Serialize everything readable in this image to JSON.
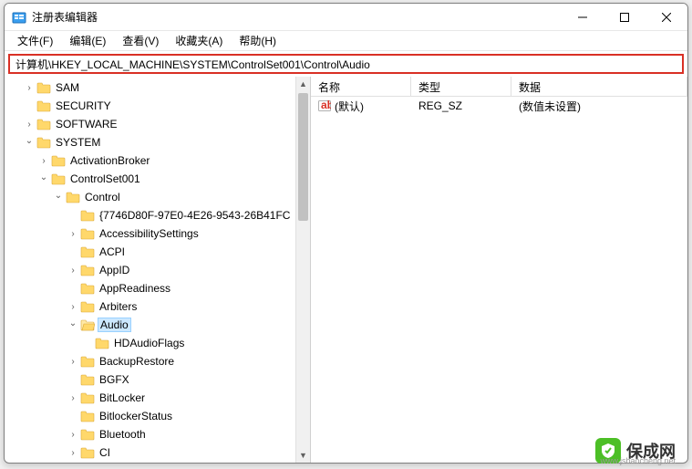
{
  "window": {
    "title": "注册表编辑器"
  },
  "menu": {
    "file": "文件(F)",
    "edit": "编辑(E)",
    "view": "查看(V)",
    "favorites": "收藏夹(A)",
    "help": "帮助(H)"
  },
  "address": "计算机\\HKEY_LOCAL_MACHINE\\SYSTEM\\ControlSet001\\Control\\Audio",
  "columns": {
    "name": "名称",
    "type": "类型",
    "data": "数据"
  },
  "row": {
    "name": "(默认)",
    "type": "REG_SZ",
    "data": "(数值未设置)"
  },
  "tree": [
    {
      "indent": 1,
      "chev": ">",
      "label": "SAM"
    },
    {
      "indent": 1,
      "chev": "",
      "label": "SECURITY"
    },
    {
      "indent": 1,
      "chev": ">",
      "label": "SOFTWARE"
    },
    {
      "indent": 1,
      "chev": "v",
      "label": "SYSTEM"
    },
    {
      "indent": 2,
      "chev": ">",
      "label": "ActivationBroker"
    },
    {
      "indent": 2,
      "chev": "v",
      "label": "ControlSet001"
    },
    {
      "indent": 3,
      "chev": "v",
      "label": "Control"
    },
    {
      "indent": 4,
      "chev": "",
      "label": "{7746D80F-97E0-4E26-9543-26B41FC"
    },
    {
      "indent": 4,
      "chev": ">",
      "label": "AccessibilitySettings"
    },
    {
      "indent": 4,
      "chev": "",
      "label": "ACPI"
    },
    {
      "indent": 4,
      "chev": ">",
      "label": "AppID"
    },
    {
      "indent": 4,
      "chev": "",
      "label": "AppReadiness"
    },
    {
      "indent": 4,
      "chev": ">",
      "label": "Arbiters"
    },
    {
      "indent": 4,
      "chev": "v",
      "label": "Audio",
      "selected": true,
      "open": true
    },
    {
      "indent": 5,
      "chev": "",
      "label": "HDAudioFlags"
    },
    {
      "indent": 4,
      "chev": ">",
      "label": "BackupRestore"
    },
    {
      "indent": 4,
      "chev": "",
      "label": "BGFX"
    },
    {
      "indent": 4,
      "chev": ">",
      "label": "BitLocker"
    },
    {
      "indent": 4,
      "chev": "",
      "label": "BitlockerStatus"
    },
    {
      "indent": 4,
      "chev": ">",
      "label": "Bluetooth"
    },
    {
      "indent": 4,
      "chev": ">",
      "label": "CI"
    }
  ],
  "watermark": {
    "text": "保成网",
    "url": "www.jsbaocheng.net"
  }
}
